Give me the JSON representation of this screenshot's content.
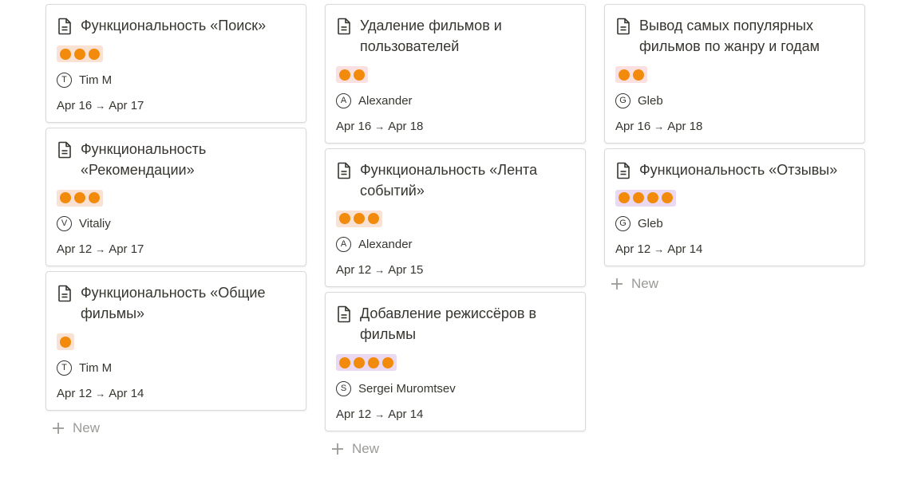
{
  "colors": {
    "dot": "#f28b0c",
    "pill_peach": "#f9e1d4",
    "pill_pink": "#fbe0e2",
    "pill_purple": "#ead9f1"
  },
  "columns": [
    {
      "cards": [
        {
          "title": "Функциональность «Поиск»",
          "priority": 3,
          "pill": "peach",
          "assignee_initial": "T",
          "assignee": "Tim M",
          "start": "Apr 16",
          "end": "Apr 17"
        },
        {
          "title": "Функциональность «Рекомендации»",
          "priority": 3,
          "pill": "peach",
          "assignee_initial": "V",
          "assignee": "Vitaliy",
          "start": "Apr 12",
          "end": "Apr 17"
        },
        {
          "title": "Функциональность «Общие фильмы»",
          "priority": 1,
          "pill": "peach",
          "assignee_initial": "T",
          "assignee": "Tim M",
          "start": "Apr 12",
          "end": "Apr 14"
        }
      ],
      "new_label": "New"
    },
    {
      "cards": [
        {
          "title": "Удаление фильмов и пользователей",
          "priority": 2,
          "pill": "pink",
          "assignee_initial": "A",
          "assignee": "Alexander",
          "start": "Apr 16",
          "end": "Apr 18"
        },
        {
          "title": "Функциональность «Лента событий»",
          "priority": 3,
          "pill": "peach",
          "assignee_initial": "A",
          "assignee": "Alexander",
          "start": "Apr 12",
          "end": "Apr 15"
        },
        {
          "title": "Добавление режиссёров в фильмы",
          "priority": 4,
          "pill": "purple",
          "assignee_initial": "S",
          "assignee": "Sergei Muromtsev",
          "start": "Apr 12",
          "end": "Apr 14"
        }
      ],
      "new_label": "New"
    },
    {
      "cards": [
        {
          "title": "Вывод самых популярных фильмов по жанру и годам",
          "priority": 2,
          "pill": "pink",
          "assignee_initial": "G",
          "assignee": "Gleb",
          "start": "Apr 16",
          "end": "Apr 18"
        },
        {
          "title": "Функциональность  «Отзывы»",
          "priority": 4,
          "pill": "purple",
          "assignee_initial": "G",
          "assignee": "Gleb",
          "start": "Apr 12",
          "end": "Apr 14"
        }
      ],
      "new_label": "New"
    }
  ],
  "arrow": "→"
}
